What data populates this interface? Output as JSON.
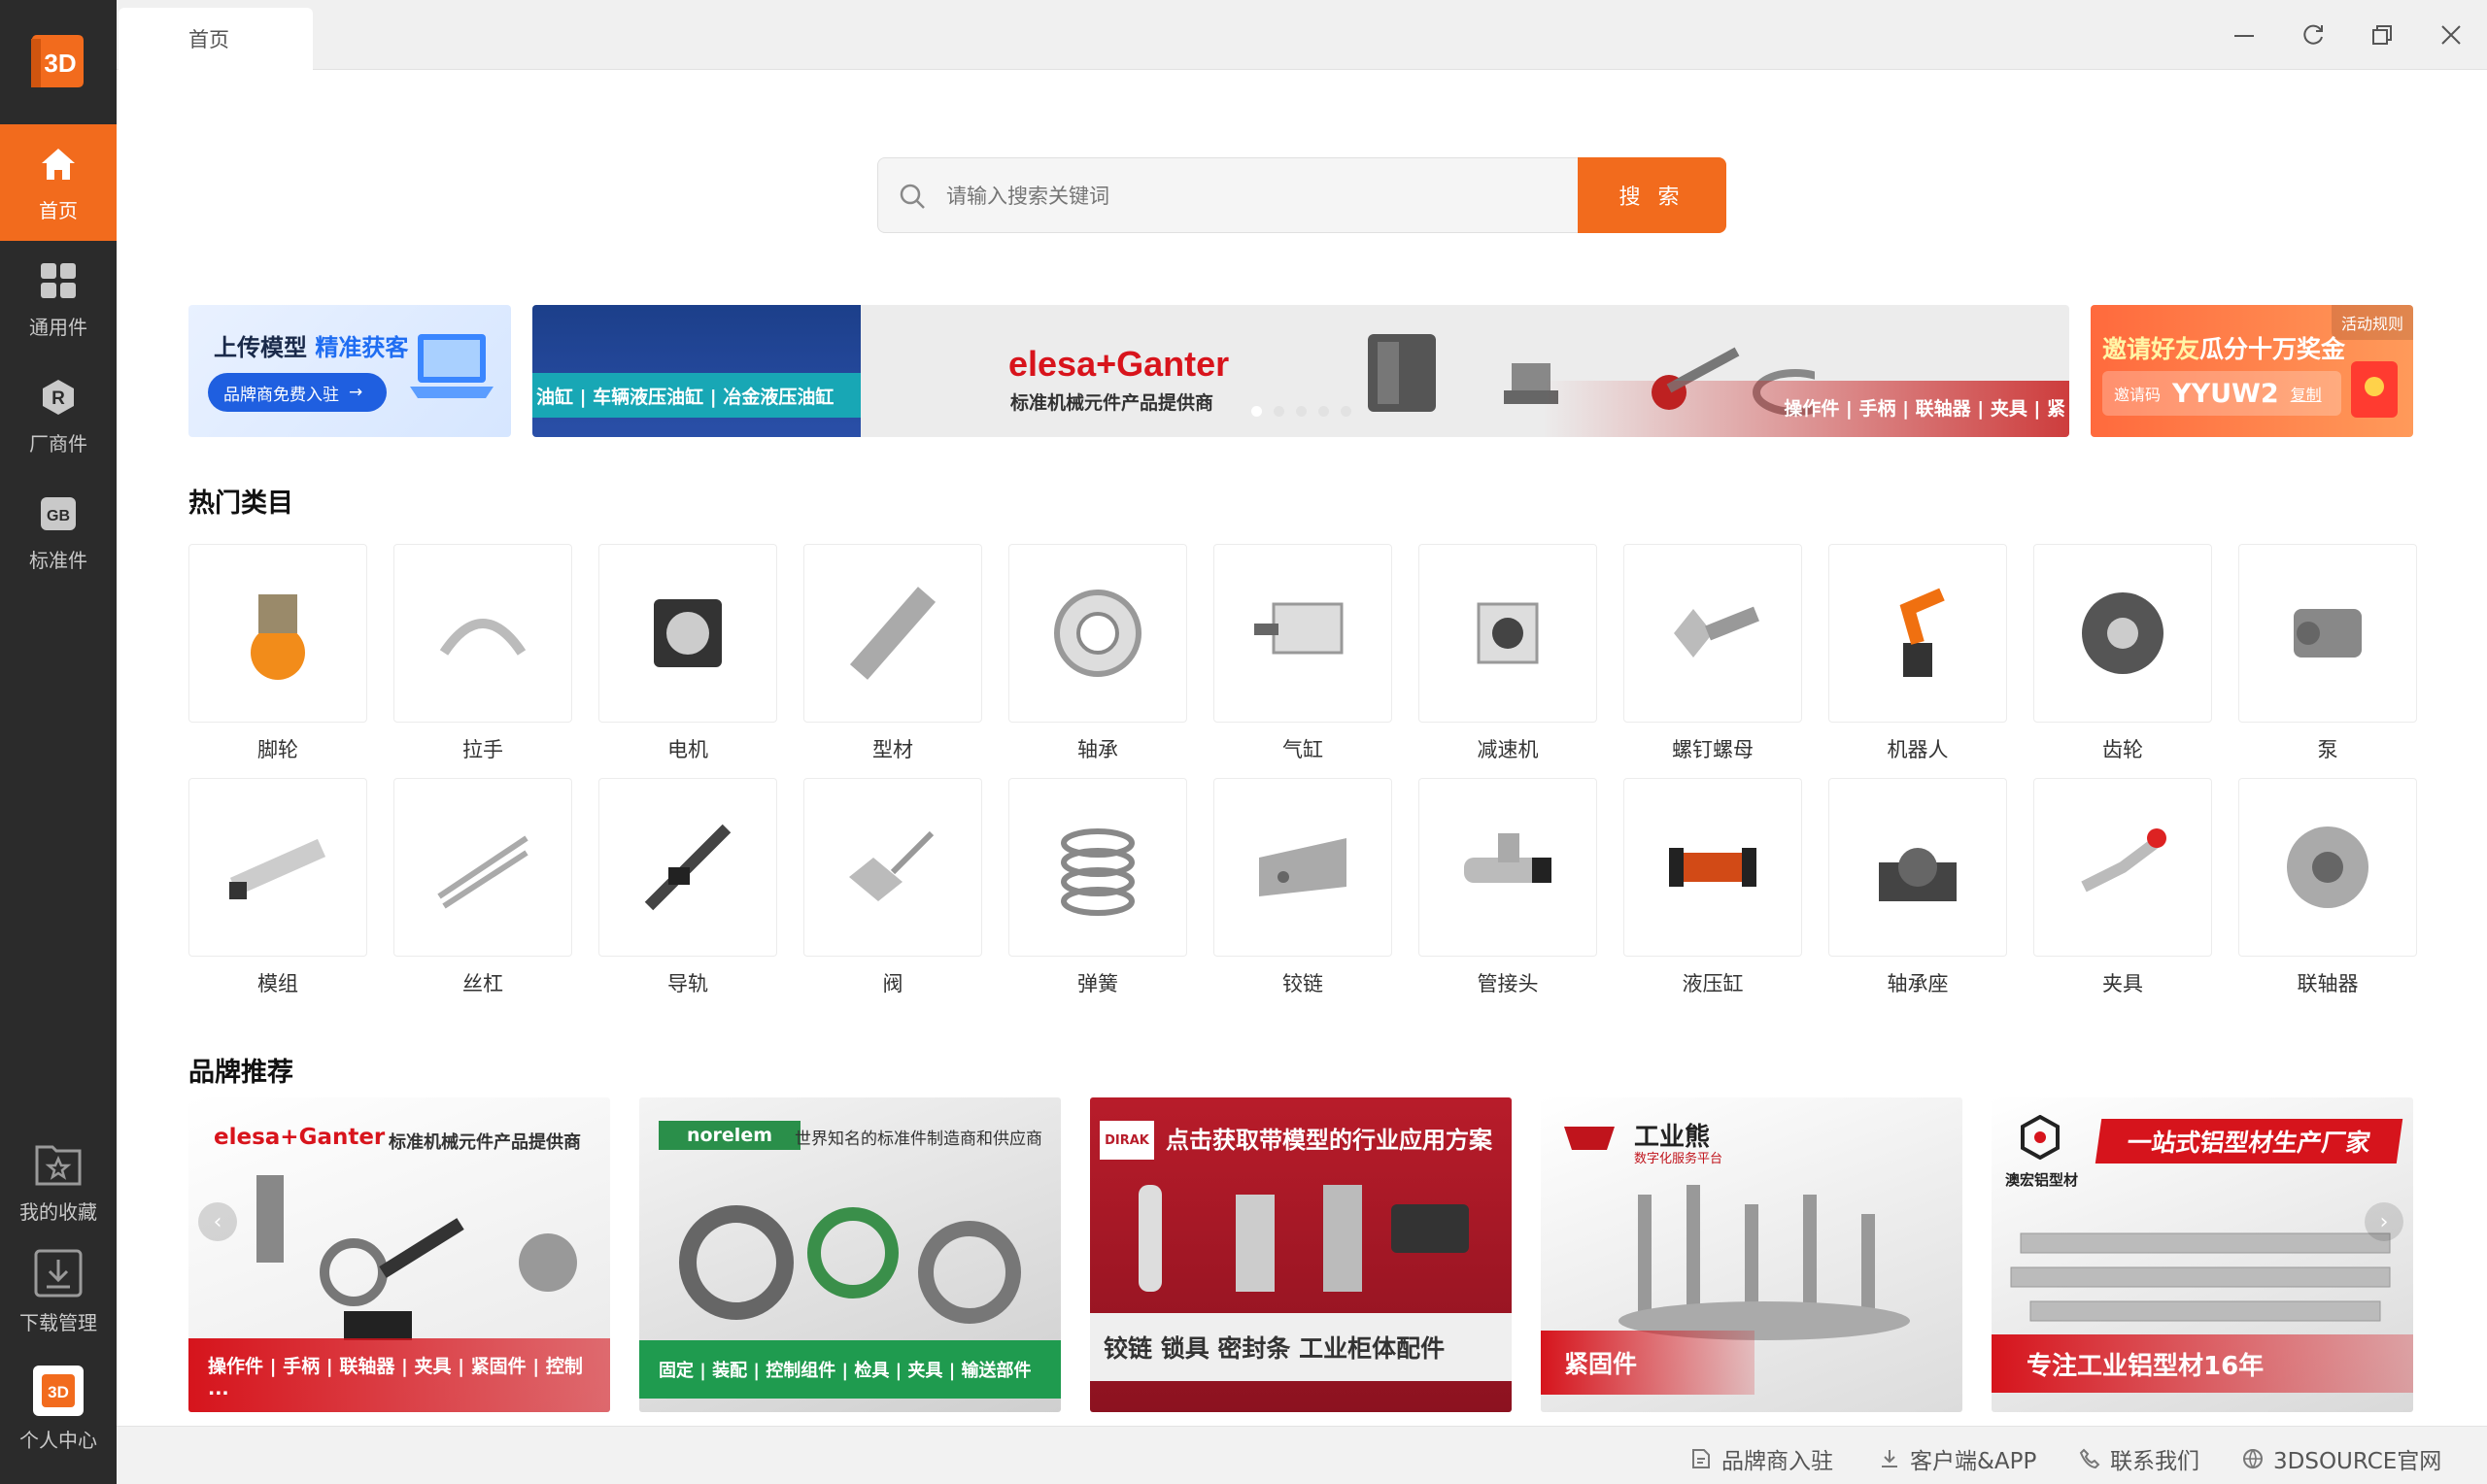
{
  "sidebar": {
    "logo_text": "3D",
    "items": [
      {
        "label": "首页",
        "icon": "home-icon"
      },
      {
        "label": "通用件",
        "icon": "grid-icon"
      },
      {
        "label": "厂商件",
        "icon": "manufacturer-icon"
      },
      {
        "label": "标准件",
        "icon": "standard-icon"
      }
    ],
    "bottom": [
      {
        "label": "我的收藏",
        "icon": "favorites-icon"
      },
      {
        "label": "下载管理",
        "icon": "download-icon"
      },
      {
        "label": "个人中心",
        "icon": "profile-icon"
      }
    ],
    "manufacturer_glyph": "R",
    "standard_glyph": "GB",
    "profile_glyph": "3D"
  },
  "titlebar": {
    "tab_label": "首页"
  },
  "search": {
    "placeholder": "请输入搜索关键词",
    "button_label": "搜 索"
  },
  "banners": {
    "upload": {
      "title_a": "上传模型",
      "title_b": "精准获客",
      "button": "品牌商免费入驻"
    },
    "main": {
      "left_caption": "油缸 | 车辆液压油缸 | 冶金液压油缸",
      "brand": "elesa+Ganter",
      "subtitle": "标准机械元件产品提供商",
      "right_caption": "操作件 | 手柄 | 联轴器 | 夹具 | 紧"
    },
    "invite": {
      "tag": "活动规则",
      "title_a": "邀请好友",
      "title_b": "瓜分十万奖金",
      "code_label": "邀请码",
      "code": "YYUW2",
      "copy": "复制"
    }
  },
  "hot_categories": {
    "title": "热门类目",
    "items": [
      "脚轮",
      "拉手",
      "电机",
      "型材",
      "轴承",
      "气缸",
      "减速机",
      "螺钉螺母",
      "机器人",
      "齿轮",
      "泵",
      "模组",
      "丝杠",
      "导轨",
      "阀",
      "弹簧",
      "铰链",
      "管接头",
      "液压缸",
      "轴承座",
      "夹具",
      "联轴器"
    ]
  },
  "brands": {
    "title": "品牌推荐",
    "items": [
      {
        "logo": "elesa+Ganter",
        "tagline": "标准机械元件产品提供商",
        "caption": "操作件 | 手柄 | 联轴器 | 夹具 | 紧固件 | 控制 ..."
      },
      {
        "logo": "norelem",
        "tagline": "世界知名的标准件制造商和供应商",
        "caption": "固定 | 装配 | 控制组件 | 检具 | 夹具 | 输送部件"
      },
      {
        "logo": "DIRAK",
        "tagline": "点击获取带模型的行业应用方案",
        "caption": "铰链  锁具  密封条  工业柜体配件"
      },
      {
        "logo": "工业熊",
        "tagline": "数字化服务平台",
        "caption": "紧固件"
      },
      {
        "logo": "澳宏铝型材",
        "tagline": "一站式铝型材生产厂家",
        "caption": "专注工业铝型材16年"
      }
    ]
  },
  "footer": {
    "links": [
      {
        "label": "品牌商入驻",
        "icon": "document-icon"
      },
      {
        "label": "客户端&APP",
        "icon": "download-icon"
      },
      {
        "label": "联系我们",
        "icon": "phone-icon"
      },
      {
        "label": "3DSOURCE官网",
        "icon": "globe-icon"
      }
    ]
  },
  "colors": {
    "accent": "#f26b1d",
    "sidebar_bg": "#2b2b2b"
  }
}
